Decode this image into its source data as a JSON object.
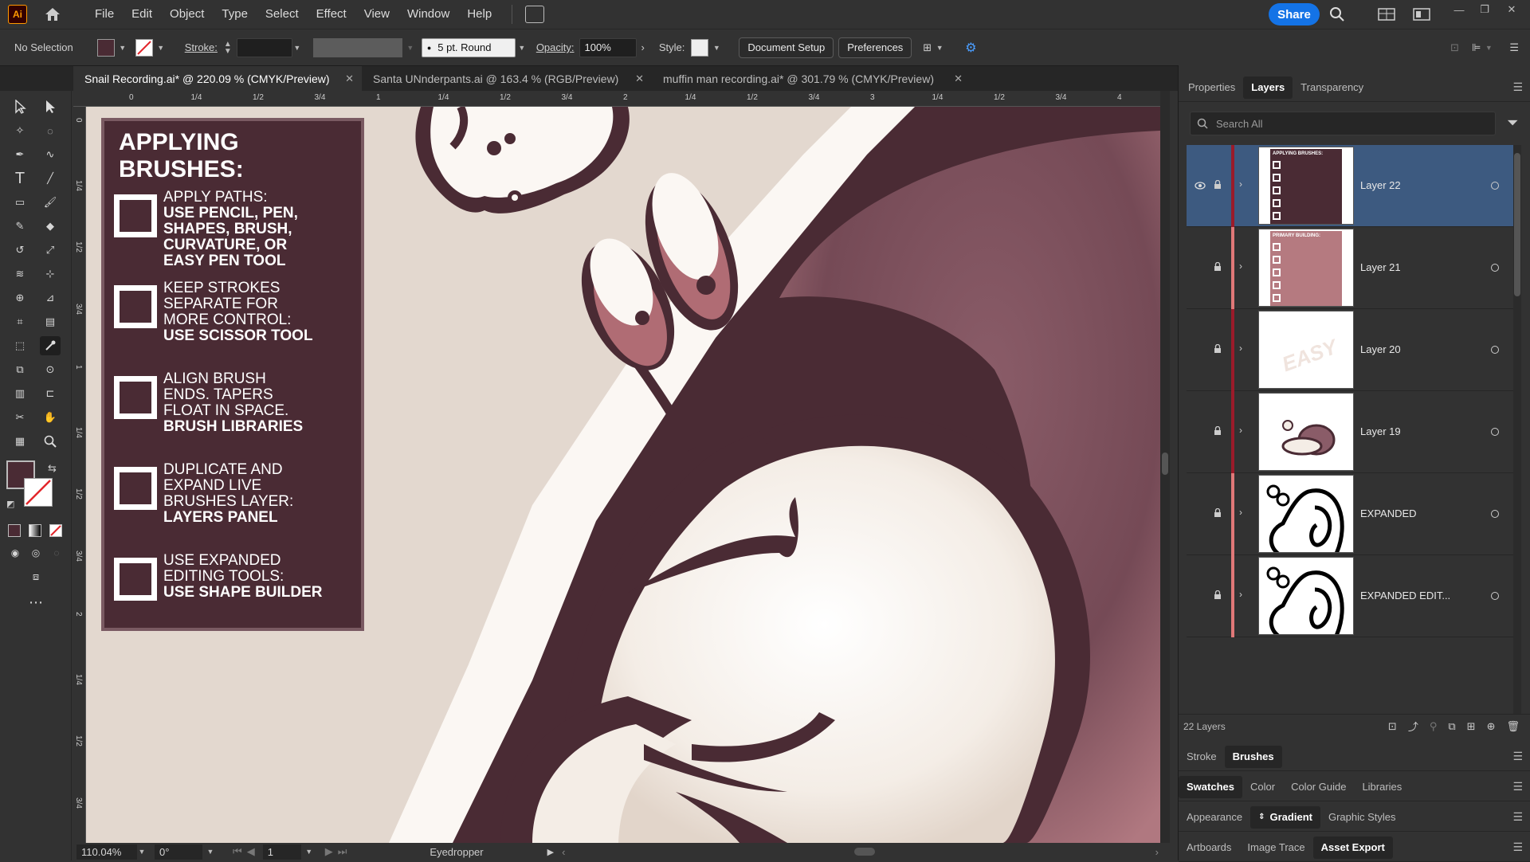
{
  "app": {
    "logo": "Ai"
  },
  "menu": [
    "File",
    "Edit",
    "Object",
    "Type",
    "Select",
    "Effect",
    "View",
    "Window",
    "Help"
  ],
  "share_label": "Share",
  "control_bar": {
    "selection": "No Selection",
    "stroke_label": "Stroke:",
    "brush": "5 pt. Round",
    "opacity_label": "Opacity:",
    "opacity_value": "100%",
    "style_label": "Style:",
    "document_setup": "Document Setup",
    "preferences": "Preferences"
  },
  "doc_tabs": [
    {
      "label": "Snail Recording.ai* @ 220.09 % (CMYK/Preview)"
    },
    {
      "label": "Santa UNnderpants.ai @ 163.4 % (RGB/Preview)"
    },
    {
      "label": "muffin man recording.ai* @ 301.79 % (CMYK/Preview)"
    }
  ],
  "ruler_h": [
    "0",
    "1/4",
    "1/2",
    "3/4",
    "1",
    "1/4",
    "1/2",
    "3/4",
    "2",
    "1/4",
    "1/2",
    "3/4",
    "3",
    "1/4",
    "1/2",
    "3/4",
    "4"
  ],
  "ruler_v": [
    "0",
    "1/4",
    "1/2",
    "3/4",
    "1",
    "1/4",
    "1/2",
    "3/4",
    "2",
    "1/4",
    "1/2",
    "3/4"
  ],
  "card": {
    "title_line1": "APPLYING",
    "title_line2": "BRUSHES:",
    "items": [
      {
        "l1": "APPLY PATHS:",
        "l2": "",
        "l3": "",
        "b1": "USE PENCIL, PEN,",
        "b2": "SHAPES, BRUSH,",
        "b3": "CURVATURE, OR",
        "b4": "EASY PEN TOOL"
      },
      {
        "l1": "KEEP STROKES",
        "l2": "SEPARATE FOR",
        "l3": "MORE CONTROL:",
        "b1": "USE SCISSOR TOOL",
        "b2": "",
        "b3": "",
        "b4": ""
      },
      {
        "l1": "ALIGN BRUSH",
        "l2": "ENDS. TAPERS",
        "l3": "FLOAT IN SPACE.",
        "b1": "BRUSH LIBRARIES",
        "b2": "",
        "b3": "",
        "b4": ""
      },
      {
        "l1": "DUPLICATE AND",
        "l2": "EXPAND LIVE",
        "l3": "BRUSHES LAYER:",
        "b1": "LAYERS PANEL",
        "b2": "",
        "b3": "",
        "b4": ""
      },
      {
        "l1": "USE EXPANDED",
        "l2": "EDITING TOOLS:",
        "l3": "",
        "b1": "USE SHAPE BUILDER",
        "b2": "",
        "b3": "",
        "b4": ""
      }
    ]
  },
  "status": {
    "zoom": "110.04%",
    "rotate": "0°",
    "artboard": "1",
    "tool": "Eyedropper"
  },
  "panel": {
    "top_tabs": [
      "Properties",
      "Layers",
      "Transparency"
    ],
    "search_placeholder": "Search All",
    "layers": [
      {
        "name": "Layer 22",
        "color": "#9b1b2a",
        "selected": true
      },
      {
        "name": "Layer 21",
        "color": "#e07878",
        "selected": false
      },
      {
        "name": "Layer 20",
        "color": "#9b1b2a",
        "selected": false
      },
      {
        "name": "Layer 19",
        "color": "#9b1b2a",
        "selected": false
      },
      {
        "name": "EXPANDED",
        "color": "#e07878",
        "selected": false
      },
      {
        "name": "EXPANDED EDIT...",
        "color": "#e07878",
        "selected": false
      }
    ],
    "thumb_texts": {
      "l22_title": "APPLYING BRUSHES:",
      "l21_title": "PRIMARY BUILDING:",
      "l20_text": "EASY"
    },
    "layer_count": "22 Layers",
    "group1": [
      "Stroke",
      "Brushes"
    ],
    "group2": [
      "Swatches",
      "Color",
      "Color Guide",
      "Libraries"
    ],
    "group3": [
      "Appearance",
      "Gradient",
      "Graphic Styles"
    ],
    "group4": [
      "Artboards",
      "Image Trace",
      "Asset Export"
    ]
  },
  "colors": {
    "accent": "#1473e6",
    "dark_maroon": "#4a2b34",
    "selected_row": "#3d5a80"
  }
}
